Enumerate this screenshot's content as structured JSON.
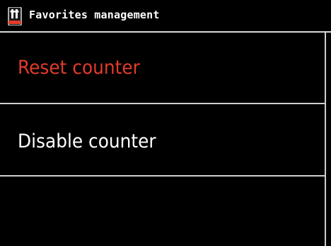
{
  "header": {
    "title": "Favorites management",
    "icon": "reset-counter-icon"
  },
  "menu": {
    "items": [
      {
        "label": "Reset counter",
        "color": "#e23b2a",
        "selected": true
      },
      {
        "label": "Disable counter",
        "color": "#ffffff",
        "selected": false
      },
      {
        "label": "",
        "color": "#ffffff",
        "selected": false
      }
    ]
  },
  "colors": {
    "background": "#000000",
    "accent": "#e23b2a",
    "text": "#ffffff",
    "divider": "#cfcfcf"
  }
}
